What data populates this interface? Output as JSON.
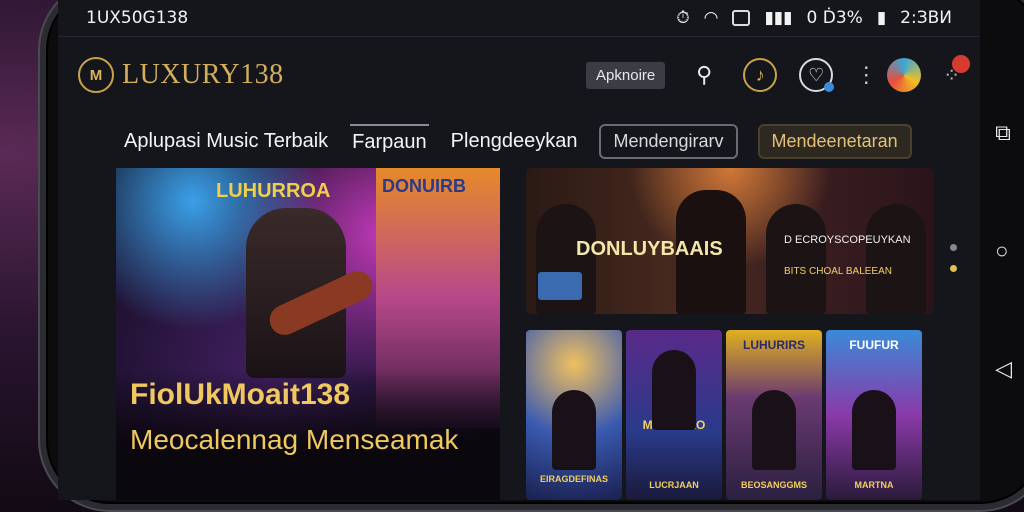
{
  "status_bar": {
    "left_text": "1UX50G138",
    "right_text": "0 Ḋ3%",
    "time": "2:ЗВИ"
  },
  "app": {
    "logo_text": "LUXURY138",
    "logo_mark": "M",
    "header_button": "Apknoire",
    "notification_count": "",
    "icons": [
      "search-icon",
      "mic-icon",
      "heart-icon",
      "kebab-icon",
      "avatar",
      "notification-icon"
    ]
  },
  "nav": {
    "tabs": [
      "Aplupasi Music Terbaik",
      "Farpaun",
      "Plengdeeykan"
    ],
    "pill_outline": "Mendengirarv",
    "pill_gold": "Mendeenetaran"
  },
  "hero": {
    "banner_title": "LUHURROA",
    "poster_title": "DONUIRB",
    "headline": "FiolUkMoait138",
    "subheadline": "Meocalennag Menseamak"
  },
  "feature": {
    "title": "DONLUYBAAIS",
    "subtitle": "D ECROYSCOPEUYKAN",
    "caption": "BITS CHOAL BALEEAN"
  },
  "grid": [
    {
      "top_label": "",
      "bottom_label": "EIRAGDEFINAS"
    },
    {
      "top_label": "MUXOKAO",
      "bottom_label": "LUCRJAAN"
    },
    {
      "top_label": "LUHURIRS",
      "bottom_label": "BEOSANGGMS"
    },
    {
      "top_label": "FUUFUR",
      "bottom_label": "MARTNA"
    }
  ],
  "colors": {
    "gold": "#d4ae5a",
    "background": "#15161c",
    "accent_blue": "#3b8cd8",
    "badge_red": "#d63a30"
  }
}
